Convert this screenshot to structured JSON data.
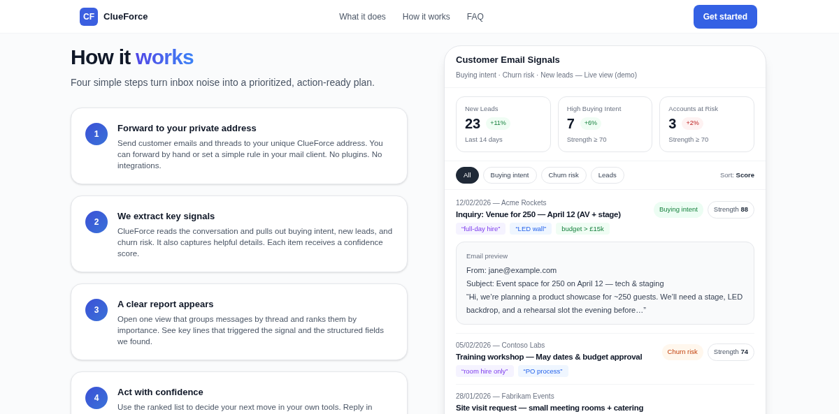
{
  "nav": {
    "logo_mark": "CF",
    "brand": "ClueForce",
    "links": [
      "What it does",
      "How it works",
      "FAQ"
    ],
    "cta": "Get started"
  },
  "hero": {
    "title": "How it",
    "title_accent": "works",
    "subtitle": "Four simple steps turn inbox noise into a prioritized, action-ready plan."
  },
  "steps": [
    {
      "number": "1",
      "title": "Forward to your private address",
      "body": "Send customer emails and threads to your unique ClueForce address. You can forward by hand or set a simple rule in your mail client. No plugins. No integrations."
    },
    {
      "number": "2",
      "title": "We extract key signals",
      "body": "ClueForce reads the conversation and pulls out buying intent, new leads, and churn risk. It also captures helpful details. Each item receives a confidence score."
    },
    {
      "number": "3",
      "title": "A clear report appears",
      "body": "Open one view that groups messages by thread and ranks them by importance. See key lines that triggered the signal and the structured fields we found."
    },
    {
      "number": "4",
      "title": "Act with confidence",
      "body": "Use the ranked list to decide your next move in your own tools. Reply in"
    }
  ],
  "panel": {
    "title": "Customer Email Signals",
    "subtitle": "Buying intent · Churn risk · New leads — Live view (demo)",
    "stats": [
      {
        "label": "New Leads",
        "value": "23",
        "delta": "+11%",
        "kind": "good",
        "note": "Last 14 days"
      },
      {
        "label": "High Buying Intent",
        "value": "7",
        "delta": "+6%",
        "kind": "good",
        "note": "Strength ≥ 70"
      },
      {
        "label": "Accounts at Risk",
        "value": "3",
        "delta": "+2%",
        "kind": "bad",
        "note": "Strength ≥ 70"
      }
    ],
    "filters": [
      {
        "label": "All",
        "selected": true
      },
      {
        "label": "Buying intent",
        "selected": false
      },
      {
        "label": "Churn risk",
        "selected": false
      },
      {
        "label": "Leads",
        "selected": false
      }
    ],
    "sort_label": "Sort:",
    "sort_value": "Score",
    "emails": [
      {
        "meta": "12/02/2026 — Acme Rockets",
        "title": "Inquiry: Venue for 250 — April 12 (AV + stage)",
        "badge": {
          "text": "Buying intent",
          "kind": "buying"
        },
        "strength_label": "Strength",
        "strength": "88",
        "tags": [
          {
            "text": "“full-day hire”",
            "kind": "requirement"
          },
          {
            "text": "“LED wall”",
            "kind": "detail"
          },
          {
            "text": "budget > £15k",
            "kind": "budget"
          }
        ],
        "preview": {
          "label": "Email preview",
          "from_label": "From:",
          "from": "jane@example.com",
          "subject_label": "Subject:",
          "subject": "Event space for 250 on April 12 — tech & staging",
          "quote": "“Hi, we’re planning a product showcase for ~250 guests. We’ll need a stage, LED backdrop, and a rehearsal slot the evening before…”"
        }
      },
      {
        "meta": "05/02/2026 — Contoso Labs",
        "title": "Training workshop — May dates & budget approval",
        "badge": {
          "text": "Churn risk",
          "kind": "churn"
        },
        "strength_label": "Strength",
        "strength": "74",
        "tags": [
          {
            "text": "“room hire only”",
            "kind": "requirement"
          },
          {
            "text": "“PO process”",
            "kind": "detail"
          }
        ]
      },
      {
        "meta": "28/01/2026 — Fabrikam Events",
        "title": "Site visit request — small meeting rooms + catering"
      }
    ]
  }
}
